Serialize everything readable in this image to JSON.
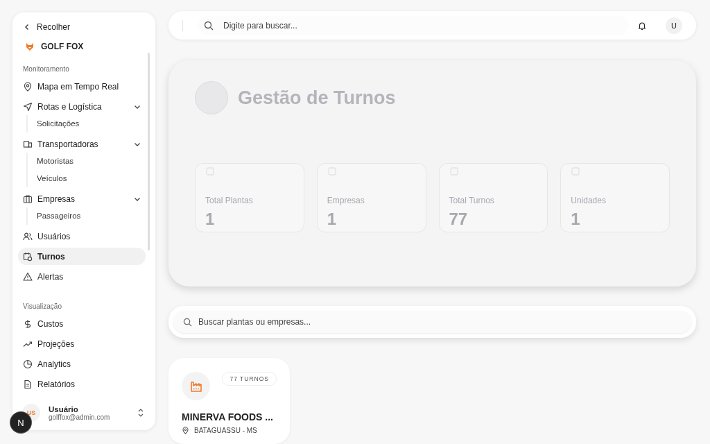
{
  "sidebar": {
    "collapse_label": "Recolher",
    "brand": "GOLF FOX",
    "sections": [
      {
        "title": "Monitoramento",
        "items": [
          {
            "label": "Mapa em Tempo Real",
            "selected": false
          },
          {
            "label": "Rotas e Logística",
            "selected": false,
            "expanded": true,
            "children": [
              {
                "label": "Solicitações"
              }
            ]
          },
          {
            "label": "Transportadoras",
            "selected": false,
            "expanded": true,
            "children": [
              {
                "label": "Motoristas"
              },
              {
                "label": "Veículos"
              }
            ]
          },
          {
            "label": "Empresas",
            "selected": false,
            "expanded": true,
            "children": [
              {
                "label": "Passageiros"
              }
            ]
          },
          {
            "label": "Usuários",
            "selected": false
          },
          {
            "label": "Turnos",
            "selected": true
          },
          {
            "label": "Alertas",
            "selected": false
          }
        ]
      },
      {
        "title": "Visualização",
        "items": [
          {
            "label": "Custos",
            "selected": false
          },
          {
            "label": "Projeções",
            "selected": false
          },
          {
            "label": "Analytics",
            "selected": false
          },
          {
            "label": "Relatórios",
            "selected": false
          }
        ]
      }
    ],
    "user": {
      "initials": "US",
      "name": "Usuário",
      "email": "golffox@admin.com"
    }
  },
  "header": {
    "search_placeholder": "Digite para buscar...",
    "avatar": "U"
  },
  "hero": {
    "title": "Gestão de Turnos",
    "stats": [
      {
        "label": "Total Plantas",
        "value": "1"
      },
      {
        "label": "Empresas",
        "value": "1"
      },
      {
        "label": "Total Turnos",
        "value": "77"
      },
      {
        "label": "Unidades",
        "value": "1"
      }
    ]
  },
  "filter": {
    "placeholder": "Buscar plantas ou empresas..."
  },
  "plants": [
    {
      "name": "MINERVA FOODS ...",
      "badge": "77 TURNOS",
      "location": "BATAGUASSU - MS"
    }
  ],
  "dev_badge": "N"
}
